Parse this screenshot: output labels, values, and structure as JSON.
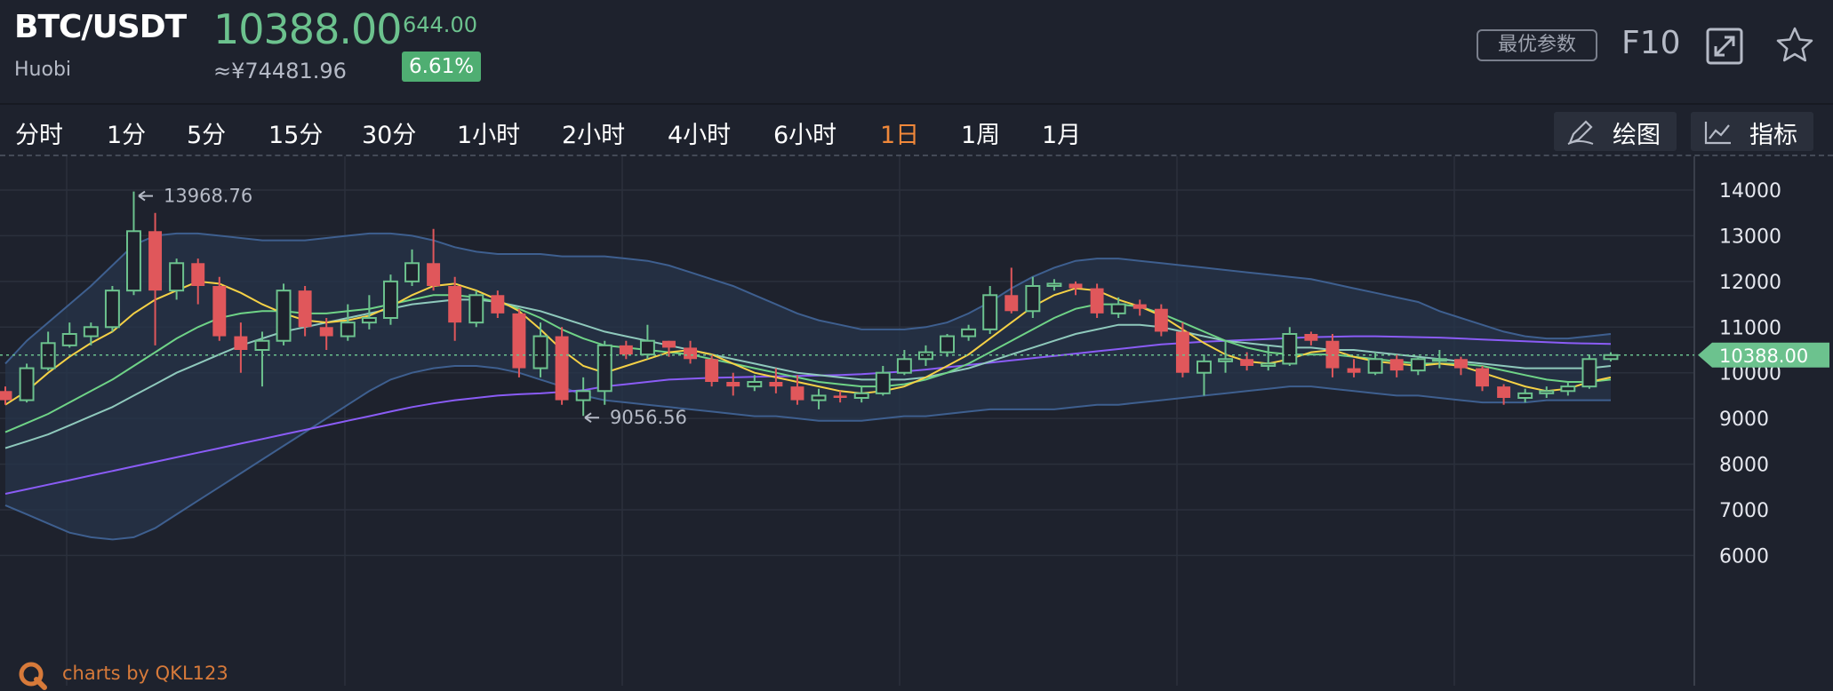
{
  "header": {
    "pair": "BTC/USDT",
    "exchange": "Huobi",
    "price": "10388.00",
    "price_cny": "≈¥74481.96",
    "change": "644.00",
    "change_pct": "6.61%",
    "optimal_params_label": "最优参数",
    "f10_label": "F10",
    "fullscreen_icon": "expand-icon",
    "favorite_icon": "star-icon"
  },
  "tabs": [
    {
      "label": "分时"
    },
    {
      "label": "1分"
    },
    {
      "label": "5分"
    },
    {
      "label": "15分"
    },
    {
      "label": "30分"
    },
    {
      "label": "1小时"
    },
    {
      "label": "2小时"
    },
    {
      "label": "4小时"
    },
    {
      "label": "6小时"
    },
    {
      "label": "1日",
      "active": true
    },
    {
      "label": "1周"
    },
    {
      "label": "1月"
    }
  ],
  "tools": {
    "draw_label": "绘图",
    "draw_icon": "pen-icon",
    "indicator_label": "指标",
    "indicator_icon": "line-chart-icon"
  },
  "colors": {
    "background": "#1e222d",
    "up": "#6cc28e",
    "down": "#e0575b",
    "active_tab": "#f0883a",
    "ma_yellow": "#f5d146",
    "ma_green": "#6fd387",
    "ma_teal": "#8fc9bc",
    "ma_purple": "#8a5cf6",
    "boll_band": "#3e5f8f",
    "watermark": "#d77a3a"
  },
  "chart_data": {
    "type": "candlestick",
    "y_ticks": [
      "14000",
      "13000",
      "12000",
      "11000",
      "10000",
      "9000",
      "8000",
      "7000",
      "6000"
    ],
    "ylim": [
      6000,
      14300
    ],
    "last_price_label": "10388.00",
    "high_annotation": "13968.76",
    "low_annotation": "9056.56",
    "grid": true,
    "candles": [
      [
        9600,
        9400,
        9700,
        9300
      ],
      [
        9400,
        10100,
        10200,
        9350
      ],
      [
        10100,
        10650,
        10900,
        10050
      ],
      [
        10600,
        10850,
        11100,
        10550
      ],
      [
        10800,
        11000,
        11100,
        10600
      ],
      [
        11000,
        11800,
        11900,
        10900
      ],
      [
        11800,
        13100,
        13968.76,
        11700
      ],
      [
        13100,
        11800,
        13500,
        10600
      ],
      [
        11800,
        12400,
        12500,
        11600
      ],
      [
        12400,
        11900,
        12500,
        11500
      ],
      [
        11900,
        10800,
        12100,
        10700
      ],
      [
        10800,
        10500,
        11100,
        10000
      ],
      [
        10500,
        10700,
        10900,
        9700
      ],
      [
        10700,
        11800,
        11950,
        10600
      ],
      [
        11800,
        11000,
        11900,
        10800
      ],
      [
        11000,
        10800,
        11200,
        10500
      ],
      [
        10800,
        11100,
        11500,
        10700
      ],
      [
        11100,
        11200,
        11700,
        10950
      ],
      [
        11200,
        12000,
        12150,
        11050
      ],
      [
        12000,
        12400,
        12700,
        11900
      ],
      [
        12400,
        11900,
        13150,
        11800
      ],
      [
        11900,
        11100,
        12100,
        10700
      ],
      [
        11100,
        11700,
        11800,
        11000
      ],
      [
        11700,
        11300,
        11800,
        11200
      ],
      [
        11300,
        10100,
        11400,
        9900
      ],
      [
        10100,
        10800,
        11100,
        9900
      ],
      [
        10800,
        9400,
        11000,
        9300
      ],
      [
        9400,
        9600,
        9900,
        9056.56
      ],
      [
        9600,
        10600,
        10700,
        9300
      ],
      [
        10600,
        10400,
        10700,
        10300
      ],
      [
        10400,
        10700,
        11050,
        10300
      ],
      [
        10700,
        10550,
        10700,
        10350
      ],
      [
        10550,
        10300,
        10700,
        10200
      ],
      [
        10300,
        9800,
        10400,
        9700
      ],
      [
        9800,
        9700,
        10000,
        9500
      ],
      [
        9700,
        9800,
        9950,
        9600
      ],
      [
        9800,
        9700,
        10100,
        9550
      ],
      [
        9700,
        9400,
        9950,
        9300
      ],
      [
        9400,
        9500,
        9650,
        9200
      ],
      [
        9500,
        9450,
        9600,
        9350
      ],
      [
        9450,
        9550,
        9700,
        9350
      ],
      [
        9550,
        10000,
        10150,
        9500
      ],
      [
        10000,
        10300,
        10500,
        9950
      ],
      [
        10300,
        10450,
        10600,
        10150
      ],
      [
        10450,
        10800,
        10850,
        10350
      ],
      [
        10800,
        10950,
        11050,
        10700
      ],
      [
        10950,
        11700,
        11900,
        10850
      ],
      [
        11700,
        11350,
        12300,
        11300
      ],
      [
        11350,
        11900,
        12100,
        11200
      ],
      [
        11900,
        11950,
        12050,
        11800
      ],
      [
        11950,
        11850,
        12000,
        11700
      ],
      [
        11850,
        11300,
        11950,
        11200
      ],
      [
        11300,
        11500,
        11650,
        11200
      ],
      [
        11500,
        11400,
        11600,
        11250
      ],
      [
        11400,
        10900,
        11500,
        10800
      ],
      [
        10900,
        10000,
        11100,
        9900
      ],
      [
        10000,
        10250,
        10400,
        9500
      ],
      [
        10250,
        10300,
        10700,
        10000
      ],
      [
        10300,
        10150,
        10450,
        10050
      ],
      [
        10150,
        10200,
        10600,
        10050
      ],
      [
        10200,
        10850,
        11000,
        10150
      ],
      [
        10850,
        10700,
        10900,
        10600
      ],
      [
        10700,
        10100,
        10850,
        9900
      ],
      [
        10100,
        10000,
        10300,
        9900
      ],
      [
        10000,
        10300,
        10450,
        9950
      ],
      [
        10300,
        10050,
        10400,
        9900
      ],
      [
        10050,
        10300,
        10350,
        9950
      ],
      [
        10300,
        10300,
        10500,
        10100
      ],
      [
        10300,
        10100,
        10350,
        9950
      ],
      [
        10100,
        9700,
        10150,
        9600
      ],
      [
        9700,
        9450,
        9750,
        9300
      ],
      [
        9450,
        9550,
        9650,
        9350
      ],
      [
        9550,
        9600,
        9700,
        9450
      ],
      [
        9600,
        9700,
        9800,
        9500
      ],
      [
        9700,
        10300,
        10400,
        9650
      ],
      [
        10300,
        10388,
        10450,
        10250
      ]
    ],
    "ma_yellow": [
      9300,
      9600,
      10000,
      10350,
      10650,
      10900,
      11300,
      11600,
      11800,
      12000,
      11950,
      11750,
      11500,
      11300,
      11150,
      11100,
      11150,
      11250,
      11450,
      11700,
      11900,
      11950,
      11800,
      11600,
      11350,
      10950,
      10500,
      10150,
      10000,
      10150,
      10300,
      10450,
      10500,
      10400,
      10200,
      10000,
      9900,
      9800,
      9700,
      9600,
      9550,
      9600,
      9700,
      9900,
      10150,
      10400,
      10750,
      11100,
      11450,
      11700,
      11850,
      11800,
      11600,
      11450,
      11250,
      10950,
      10650,
      10400,
      10250,
      10200,
      10300,
      10450,
      10500,
      10350,
      10250,
      10200,
      10150,
      10200,
      10150,
      10000,
      9850,
      9700,
      9600,
      9650,
      9800,
      9900
    ],
    "ma_green": [
      8700,
      8900,
      9100,
      9350,
      9600,
      9850,
      10150,
      10450,
      10750,
      11000,
      11200,
      11300,
      11350,
      11350,
      11300,
      11300,
      11350,
      11400,
      11500,
      11600,
      11700,
      11700,
      11650,
      11550,
      11400,
      11200,
      10950,
      10750,
      10600,
      10550,
      10500,
      10450,
      10400,
      10300,
      10200,
      10100,
      10000,
      9900,
      9800,
      9750,
      9700,
      9700,
      9750,
      9850,
      10000,
      10200,
      10450,
      10700,
      10950,
      11200,
      11400,
      11500,
      11500,
      11450,
      11300,
      11100,
      10900,
      10700,
      10550,
      10450,
      10400,
      10400,
      10400,
      10350,
      10300,
      10250,
      10200,
      10200,
      10200,
      10150,
      10050,
      9950,
      9850,
      9800,
      9800,
      9850
    ],
    "ma_teal": [
      8350,
      8500,
      8650,
      8850,
      9050,
      9250,
      9500,
      9750,
      10000,
      10200,
      10400,
      10600,
      10750,
      10900,
      11000,
      11100,
      11200,
      11300,
      11400,
      11500,
      11550,
      11600,
      11600,
      11550,
      11450,
      11350,
      11200,
      11050,
      10900,
      10800,
      10700,
      10600,
      10500,
      10400,
      10300,
      10200,
      10100,
      10000,
      9950,
      9900,
      9850,
      9850,
      9850,
      9900,
      10000,
      10100,
      10250,
      10400,
      10550,
      10700,
      10850,
      10950,
      11050,
      11050,
      11000,
      10900,
      10800,
      10700,
      10650,
      10600,
      10550,
      10550,
      10500,
      10500,
      10450,
      10400,
      10350,
      10300,
      10250,
      10200,
      10150,
      10100,
      10100,
      10100,
      10100,
      10150
    ],
    "ma_purple": [
      7350,
      7450,
      7550,
      7650,
      7750,
      7850,
      7950,
      8050,
      8150,
      8250,
      8350,
      8450,
      8550,
      8650,
      8750,
      8850,
      8950,
      9050,
      9150,
      9250,
      9330,
      9400,
      9450,
      9500,
      9530,
      9550,
      9580,
      9620,
      9700,
      9750,
      9800,
      9850,
      9870,
      9890,
      9900,
      9910,
      9920,
      9930,
      9940,
      9950,
      9970,
      10000,
      10030,
      10070,
      10120,
      10170,
      10220,
      10270,
      10320,
      10370,
      10420,
      10470,
      10520,
      10570,
      10620,
      10650,
      10680,
      10700,
      10720,
      10740,
      10760,
      10780,
      10790,
      10800,
      10800,
      10790,
      10780,
      10770,
      10750,
      10730,
      10710,
      10690,
      10670,
      10650,
      10640,
      10630
    ],
    "boll_upper": [
      10200,
      10700,
      11100,
      11500,
      11900,
      12350,
      12800,
      13000,
      13050,
      13050,
      13000,
      12950,
      12900,
      12900,
      12900,
      12950,
      13000,
      13050,
      13050,
      13000,
      12900,
      12750,
      12650,
      12600,
      12600,
      12600,
      12550,
      12550,
      12550,
      12500,
      12450,
      12350,
      12200,
      12050,
      11900,
      11700,
      11500,
      11300,
      11150,
      11050,
      10950,
      10950,
      10950,
      11000,
      11100,
      11300,
      11550,
      11850,
      12100,
      12300,
      12450,
      12500,
      12500,
      12450,
      12400,
      12350,
      12300,
      12250,
      12200,
      12150,
      12100,
      12050,
      11950,
      11850,
      11750,
      11650,
      11550,
      11350,
      11200,
      11050,
      10900,
      10800,
      10750,
      10750,
      10800,
      10850
    ],
    "boll_lower": [
      7100,
      6900,
      6700,
      6500,
      6400,
      6350,
      6400,
      6600,
      6900,
      7200,
      7500,
      7800,
      8100,
      8400,
      8700,
      9000,
      9300,
      9600,
      9850,
      10000,
      10100,
      10150,
      10150,
      10100,
      10000,
      9850,
      9700,
      9500,
      9400,
      9350,
      9300,
      9250,
      9200,
      9150,
      9100,
      9050,
      9050,
      9000,
      8950,
      8950,
      8950,
      9000,
      9050,
      9050,
      9100,
      9150,
      9200,
      9200,
      9200,
      9200,
      9250,
      9300,
      9300,
      9350,
      9400,
      9450,
      9500,
      9550,
      9600,
      9650,
      9700,
      9700,
      9650,
      9600,
      9550,
      9500,
      9500,
      9450,
      9400,
      9350,
      9350,
      9350,
      9400,
      9400,
      9400,
      9400
    ],
    "boll_mid": [
      8650,
      8800,
      8900,
      9000,
      9150,
      9350,
      9600,
      9800,
      10000,
      10150,
      10250,
      10350,
      10500,
      10650,
      10800,
      10950,
      11150,
      11300,
      11450,
      11500,
      11500,
      11450,
      11400,
      11350,
      11300,
      11200,
      11100,
      11000,
      10950,
      10900,
      10850,
      10800,
      10700,
      10600,
      10500,
      10400,
      10250,
      10150,
      10050,
      10000,
      9950,
      9950,
      10000,
      10050,
      10100,
      10200,
      10350,
      10500,
      10650,
      10750,
      10850,
      10900,
      10900,
      10900,
      10900,
      10900,
      10900,
      10900,
      10900,
      10900,
      10900,
      10850,
      10800,
      10750,
      10650,
      10550,
      10500,
      10400,
      10300,
      10200,
      10100,
      10050,
      10050,
      10050,
      10100,
      10150
    ]
  },
  "watermark_text": "charts by QKL123"
}
